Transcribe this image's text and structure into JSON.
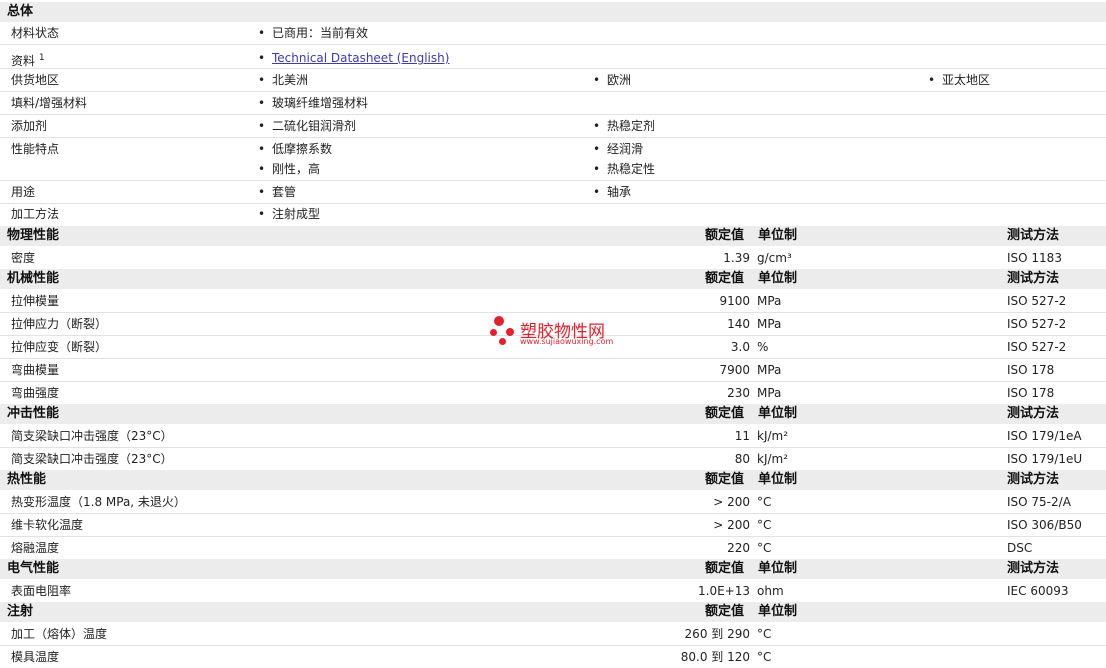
{
  "general": {
    "header": "总体",
    "status_label": "材料状态",
    "status_value": "已商用：当前有效",
    "docs_label": "资料",
    "docs_sup": "1",
    "docs_link": "Technical Datasheet (English)",
    "region_label": "供货地区",
    "regions": [
      "北美洲",
      "欧洲",
      "亚太地区"
    ],
    "filler_label": "填料/增强材料",
    "filler_value": "玻璃纤维增强材料",
    "additive_label": "添加剂",
    "additives": [
      "二硫化钼润滑剂",
      "热稳定剂"
    ],
    "features_label": "性能特点",
    "features": [
      "低摩擦系数",
      "经润滑",
      "刚性，高",
      "热稳定性"
    ],
    "uses_label": "用途",
    "uses": [
      "套管",
      "轴承"
    ],
    "process_label": "加工方法",
    "process_value": "注射成型"
  },
  "col_headers": {
    "value": "额定值",
    "unit": "单位制",
    "method": "测试方法"
  },
  "physical": {
    "header": "物理性能",
    "rows": [
      {
        "name": "密度",
        "value": "1.39",
        "unit": "g/cm³",
        "method": "ISO 1183"
      }
    ]
  },
  "mechanical": {
    "header": "机械性能",
    "rows": [
      {
        "name": "拉伸模量",
        "value": "9100",
        "unit": "MPa",
        "method": "ISO 527-2"
      },
      {
        "name": "拉伸应力（断裂）",
        "value": "140",
        "unit": "MPa",
        "method": "ISO 527-2"
      },
      {
        "name": "拉伸应变（断裂）",
        "value": "3.0",
        "unit": "%",
        "method": "ISO 527-2"
      },
      {
        "name": "弯曲模量",
        "value": "7900",
        "unit": "MPa",
        "method": "ISO 178"
      },
      {
        "name": "弯曲强度",
        "value": "230",
        "unit": "MPa",
        "method": "ISO 178"
      }
    ]
  },
  "impact": {
    "header": "冲击性能",
    "rows": [
      {
        "name": "简支梁缺口冲击强度（23°C）",
        "value": "11",
        "unit": "kJ/m²",
        "method": "ISO 179/1eA"
      },
      {
        "name": "简支梁缺口冲击强度（23°C）",
        "value": "80",
        "unit": "kJ/m²",
        "method": "ISO 179/1eU"
      }
    ]
  },
  "thermal": {
    "header": "热性能",
    "rows": [
      {
        "name": "热变形温度（1.8 MPa, 未退火）",
        "value": "> 200",
        "unit": "°C",
        "method": "ISO 75-2/A"
      },
      {
        "name": "维卡软化温度",
        "value": "> 200",
        "unit": "°C",
        "method": "ISO 306/B50"
      },
      {
        "name": "熔融温度",
        "value": "220",
        "unit": "°C",
        "method": "DSC"
      }
    ]
  },
  "electrical": {
    "header": "电气性能",
    "rows": [
      {
        "name": "表面电阻率",
        "value": "1.0E+13",
        "unit": "ohm",
        "method": "IEC 60093"
      }
    ]
  },
  "injection": {
    "header": "注射",
    "rows": [
      {
        "name": "加工（熔体）温度",
        "value": "260 到 290",
        "unit": "°C"
      },
      {
        "name": "模具温度",
        "value": "80.0 到 120",
        "unit": "°C"
      }
    ]
  },
  "watermark": {
    "cn": "塑胶物性网",
    "en": "www.sujiaowuxing.com",
    "color": "#e4202a"
  }
}
